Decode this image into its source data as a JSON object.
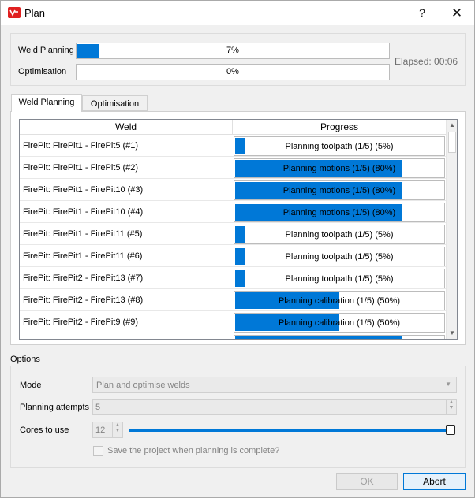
{
  "window": {
    "title": "Plan",
    "help_label": "?",
    "close_label": "✕"
  },
  "progress": {
    "weld_planning": {
      "label": "Weld Planning",
      "text": "7%",
      "fraction": 0.07
    },
    "optimisation": {
      "label": "Optimisation",
      "text": "0%",
      "fraction": 0.0
    },
    "elapsed": "Elapsed: 00:06"
  },
  "tabs": [
    {
      "label": "Weld Planning",
      "active": true
    },
    {
      "label": "Optimisation",
      "active": false
    }
  ],
  "table": {
    "columns": [
      "Weld",
      "Progress"
    ],
    "rows": [
      {
        "weld": "FirePit: FirePit1 - FirePit5 (#1)",
        "progress": "Planning toolpath (1/5) (5%)",
        "fraction": 0.05
      },
      {
        "weld": "FirePit: FirePit1 - FirePit5 (#2)",
        "progress": "Planning motions (1/5) (80%)",
        "fraction": 0.8
      },
      {
        "weld": "FirePit: FirePit1 - FirePit10 (#3)",
        "progress": "Planning motions (1/5) (80%)",
        "fraction": 0.8
      },
      {
        "weld": "FirePit: FirePit1 - FirePit10 (#4)",
        "progress": "Planning motions (1/5) (80%)",
        "fraction": 0.8
      },
      {
        "weld": "FirePit: FirePit1 - FirePit11 (#5)",
        "progress": "Planning toolpath (1/5) (5%)",
        "fraction": 0.05
      },
      {
        "weld": "FirePit: FirePit1 - FirePit11 (#6)",
        "progress": "Planning toolpath (1/5) (5%)",
        "fraction": 0.05
      },
      {
        "weld": "FirePit: FirePit2 - FirePit13 (#7)",
        "progress": "Planning toolpath (1/5) (5%)",
        "fraction": 0.05
      },
      {
        "weld": "FirePit: FirePit2 - FirePit13 (#8)",
        "progress": "Planning calibration (1/5) (50%)",
        "fraction": 0.5
      },
      {
        "weld": "FirePit: FirePit2 - FirePit9 (#9)",
        "progress": "Planning calibration (1/5) (50%)",
        "fraction": 0.5
      },
      {
        "weld": "",
        "progress": "",
        "fraction": 0.8
      }
    ]
  },
  "options": {
    "group_label": "Options",
    "mode": {
      "label": "Mode",
      "value": "Plan and optimise welds"
    },
    "attempts": {
      "label": "Planning attempts",
      "value": "5"
    },
    "cores": {
      "label": "Cores to use",
      "value": "12",
      "slider_fraction": 1.0
    },
    "save_checkbox": {
      "label": "Save the project when planning is complete?",
      "checked": false
    }
  },
  "buttons": {
    "ok": "OK",
    "abort": "Abort"
  },
  "colors": {
    "accent": "#0078d7",
    "app_icon": "#e02020"
  }
}
